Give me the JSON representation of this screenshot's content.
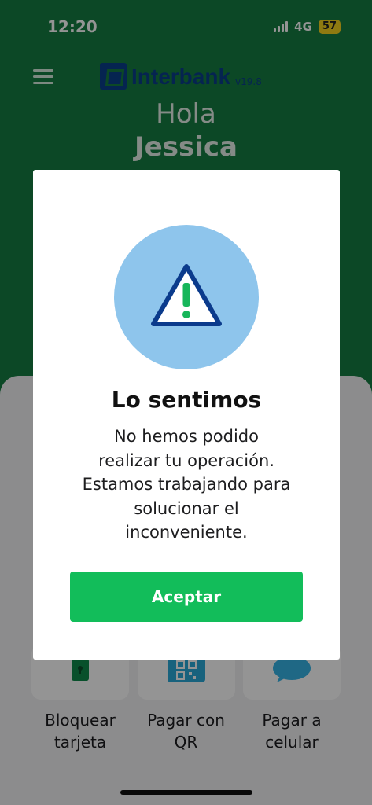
{
  "status_bar": {
    "time": "12:20",
    "network": "4G",
    "battery": "57"
  },
  "header": {
    "brand": "Interbank",
    "version": "v19.8"
  },
  "greeting": {
    "hello": "Hola",
    "name": "Jessica"
  },
  "shortcuts": [
    {
      "label_line1": "Bloquear",
      "label_line2": "tarjeta",
      "icon": "lock-card-icon"
    },
    {
      "label_line1": "Pagar con",
      "label_line2": "QR",
      "icon": "qr-code-icon"
    },
    {
      "label_line1": "Pagar a",
      "label_line2": "celular",
      "icon": "plin-icon"
    }
  ],
  "modal": {
    "title": "Lo sentimos",
    "message_lines": [
      "No hemos podido",
      "realizar tu operación.",
      "Estamos trabajando para",
      "solucionar el",
      "inconveniente."
    ],
    "accept_label": "Aceptar",
    "icon": "warning-icon"
  },
  "colors": {
    "brand_green": "#167d43",
    "brand_blue": "#0a3f8a",
    "button_green": "#12bd5a",
    "alert_circle": "#8ec5ec",
    "alert_exclamation": "#17b65a"
  }
}
